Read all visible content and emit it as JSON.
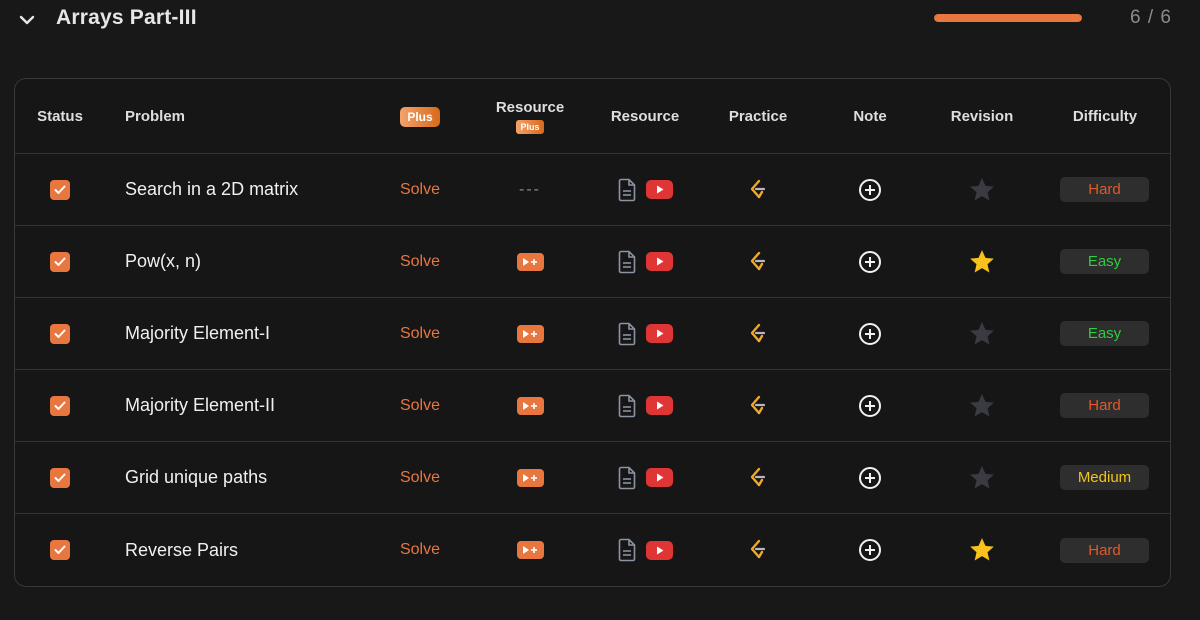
{
  "section": {
    "title": "Arrays Part-III",
    "progress_fraction": 1.0,
    "progress_text": "6 / 6"
  },
  "colors": {
    "accent": "#e8763f",
    "hard": "#e05a2b",
    "easy": "#2ecc40",
    "medium": "#f0c419",
    "star_on": "#f8c11c",
    "star_off": "#3a3a42",
    "youtube": "#e03535"
  },
  "table": {
    "headers": {
      "status": "Status",
      "problem": "Problem",
      "plus": "Plus",
      "resource_plus": "Resource",
      "resource_plus_badge": "Plus",
      "resource": "Resource",
      "practice": "Practice",
      "note": "Note",
      "revision": "Revision",
      "difficulty": "Difficulty"
    },
    "rows": [
      {
        "name": "Search in a 2D matrix",
        "solve": "Solve",
        "plus_resource": "---",
        "has_video_plus": false,
        "starred": false,
        "difficulty": "Hard"
      },
      {
        "name": "Pow(x, n)",
        "solve": "Solve",
        "plus_resource": "",
        "has_video_plus": true,
        "starred": true,
        "difficulty": "Easy"
      },
      {
        "name": "Majority Element-I",
        "solve": "Solve",
        "plus_resource": "",
        "has_video_plus": true,
        "starred": false,
        "difficulty": "Easy"
      },
      {
        "name": "Majority Element-II",
        "solve": "Solve",
        "plus_resource": "",
        "has_video_plus": true,
        "starred": false,
        "difficulty": "Hard"
      },
      {
        "name": "Grid unique paths",
        "solve": "Solve",
        "plus_resource": "",
        "has_video_plus": true,
        "starred": false,
        "difficulty": "Medium"
      },
      {
        "name": "Reverse Pairs",
        "solve": "Solve",
        "plus_resource": "",
        "has_video_plus": true,
        "starred": true,
        "difficulty": "Hard"
      }
    ]
  },
  "icons": {
    "collapse": "chevron-down-icon",
    "status": "checkbox-checked-icon",
    "article": "document-icon",
    "video": "youtube-icon",
    "video_plus": "video-plus-icon",
    "practice": "leetcode-icon",
    "note": "add-note-icon",
    "revision": "star-icon"
  }
}
